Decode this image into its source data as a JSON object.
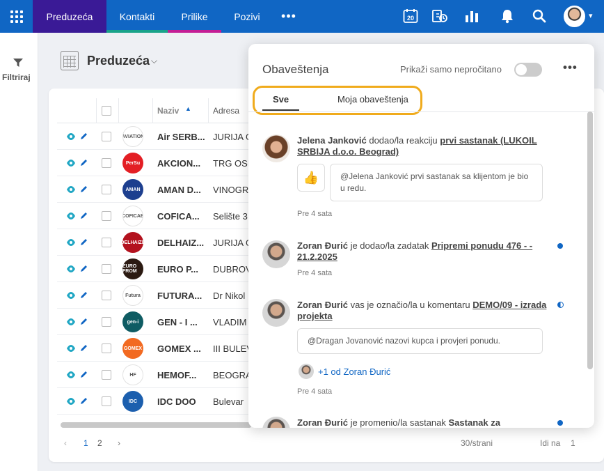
{
  "nav": {
    "tabs": [
      "Preduzeća",
      "Kontakti",
      "Prilike",
      "Pozivi"
    ],
    "more": "•••",
    "calendar_day": "20"
  },
  "filter": {
    "label": "Filtriraj"
  },
  "page": {
    "title": "Preduzeća"
  },
  "table": {
    "columns": {
      "name": "Naziv",
      "address": "Adresa"
    },
    "rows": [
      {
        "name": "Air SERB...",
        "address": "JURIJA G",
        "logo_text": "AVIATION",
        "logo_color": "#ffffff"
      },
      {
        "name": "AKCION...",
        "address": "TRG OSL",
        "logo_text": "PerSu",
        "logo_color": "#e31e24"
      },
      {
        "name": "AMAN D...",
        "address": "VINOGR",
        "logo_text": "AMAN",
        "logo_color": "#1d3f8f"
      },
      {
        "name": "COFICA...",
        "address": "Selište 3",
        "logo_text": "COFICAB",
        "logo_color": "#ffffff"
      },
      {
        "name": "DELHAIZ...",
        "address": "JURIJA G",
        "logo_text": "DELHAIZE",
        "logo_color": "#b3121e"
      },
      {
        "name": "EURO P...",
        "address": "DUBROV",
        "logo_text": "EURO FROM",
        "logo_color": "#2b1a12"
      },
      {
        "name": "FUTURA...",
        "address": "Dr Nikol",
        "logo_text": "Futura",
        "logo_color": "#ffffff"
      },
      {
        "name": "GEN - I ...",
        "address": "VLADIM",
        "logo_text": "gen-i",
        "logo_color": "#0f5c63"
      },
      {
        "name": "GOMEX ...",
        "address": "III BULEV",
        "logo_text": "GOMEX",
        "logo_color": "#f26a21"
      },
      {
        "name": "HEMOF...",
        "address": "BEOGRA",
        "logo_text": "HF",
        "logo_color": "#ffffff"
      },
      {
        "name": "IDC DOO",
        "address": "Bulevar",
        "logo_text": "IDC",
        "logo_color": "#1c5fae"
      }
    ]
  },
  "pagination": {
    "pages": [
      "1",
      "2"
    ],
    "per_page": "30/strani",
    "goto_label": "Idi na",
    "goto_value": "1"
  },
  "notifications": {
    "title": "Obaveštenja",
    "toggle_label": "Prikaži samo nepročitano",
    "tabs": {
      "all": "Sve",
      "mine": "Moja obaveštenja"
    },
    "items": [
      {
        "author": "Jelena Janković",
        "action": " dodao/la reakciju ",
        "link": "prvi sastanak (LUKOIL SRBIJA d.o.o. Beograd)",
        "reaction": "👍",
        "quote": "@Jelena Janković prvi sastanak sa klijentom je bio u redu.",
        "time": "Pre 4 sata"
      },
      {
        "author": "Zoran Đurić",
        "action": " je dodao/la zadatak ",
        "link": "Pripremi ponudu 476 - - 21.2.2025",
        "time": "Pre 4 sata"
      },
      {
        "author": "Zoran Đurić",
        "action": " vas je označio/la u komentaru ",
        "link": "DEMO/09 - izrada projekta",
        "quote": "@Dragan Jovanović nazovi kupca i provjeri ponudu.",
        "plus": "+1 od Zoran Đurić",
        "time": "Pre 4 sata"
      },
      {
        "author": "Zoran Đurić",
        "action": " je promenio/la sastanak ",
        "link": "Sastanak za"
      }
    ]
  }
}
